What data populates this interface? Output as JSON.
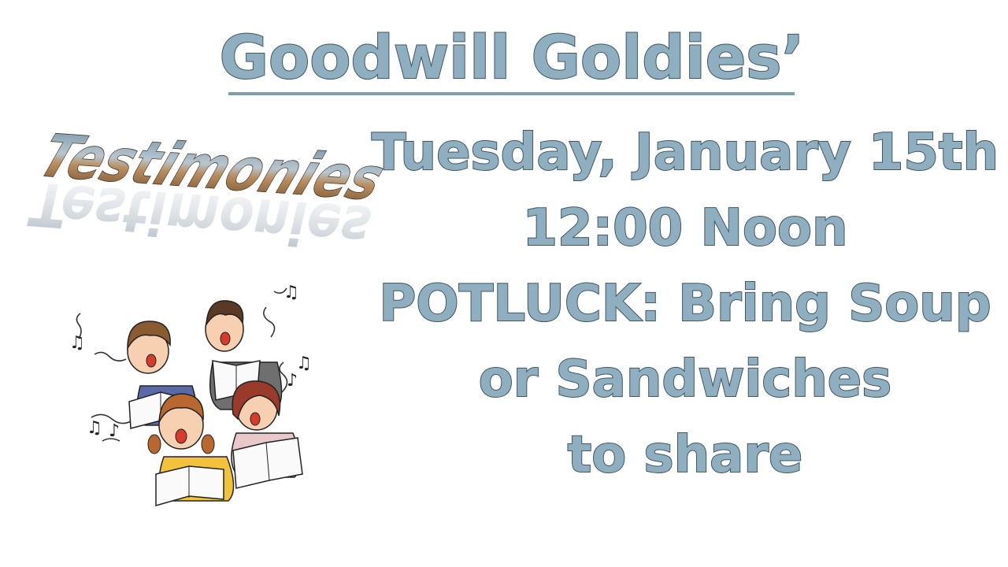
{
  "title": "Goodwill Goldies’",
  "wordart_text": "Testimonies",
  "details": {
    "line1": "Tuesday, January 15th",
    "line2": "12:00 Noon",
    "line3": "POTLUCK: Bring Soup",
    "line4": "or Sandwiches",
    "line5": "to share"
  },
  "colors": {
    "text_fill": "#8fafc0",
    "text_outline": "#3f5663",
    "background": "#ffffff"
  },
  "illustration": "singing-choir-children"
}
